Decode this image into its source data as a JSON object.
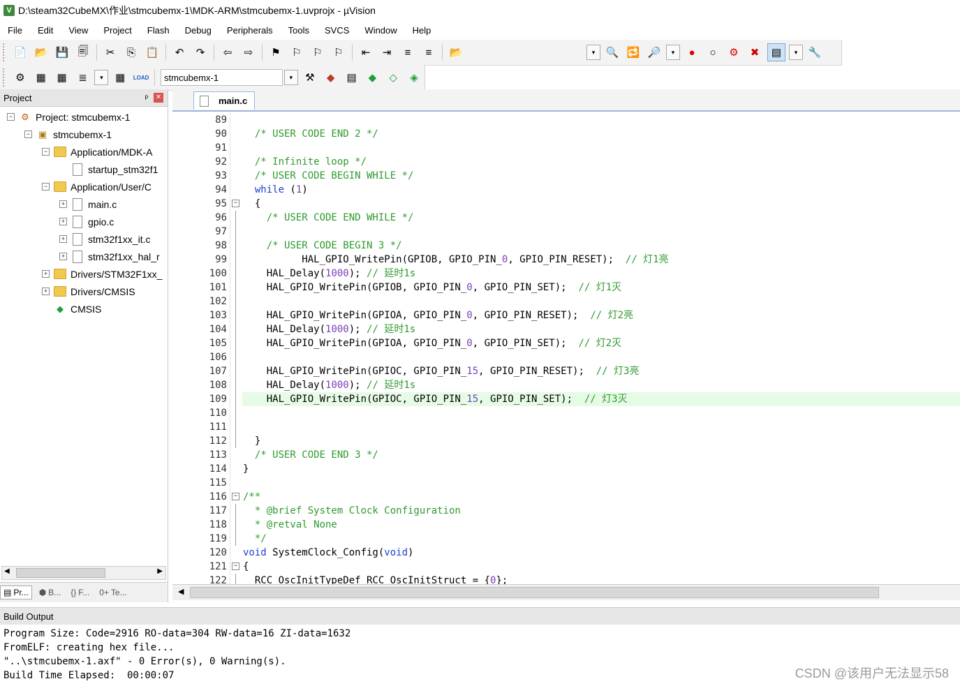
{
  "titlebar": {
    "icon": "V",
    "title": "D:\\steam32CubeMX\\作业\\stmcubemx-1\\MDK-ARM\\stmcubemx-1.uvprojx - µVision"
  },
  "menu": [
    "File",
    "Edit",
    "View",
    "Project",
    "Flash",
    "Debug",
    "Peripherals",
    "Tools",
    "SVCS",
    "Window",
    "Help"
  ],
  "toolbar": {
    "row1": [
      "📄",
      "📂",
      "💾",
      "🗐",
      "✂",
      "⎘",
      "📋",
      "↶",
      "↷",
      "⇦",
      "⇨",
      "⚑",
      "⚐",
      "⚐",
      "⚐",
      "⇤",
      "⇥",
      "≡",
      "≡",
      "📂"
    ],
    "row1_right": [
      "▾",
      "🔍",
      "🔁",
      "🔎",
      "▾",
      "●",
      "○",
      "⚙",
      "✖",
      "▤",
      "▾",
      "🔧"
    ],
    "row2": [
      "⚙",
      "▦",
      "▦",
      "≣",
      "▾",
      "▦",
      "LOAD"
    ],
    "target": "stmcubemx-1",
    "row2_right": [
      "⚒",
      "◆",
      "▤",
      "◆",
      "◇",
      "◈"
    ]
  },
  "project_panel": {
    "title": "Project",
    "pin": "ᵖ",
    "close": "✕",
    "tree": [
      {
        "level": 0,
        "exp": "−",
        "icon": "project",
        "label": "Project: stmcubemx-1"
      },
      {
        "level": 1,
        "exp": "−",
        "icon": "target",
        "label": "stmcubemx-1"
      },
      {
        "level": 2,
        "exp": "−",
        "icon": "folder",
        "label": "Application/MDK-A"
      },
      {
        "level": 3,
        "exp": "",
        "icon": "file",
        "label": "startup_stm32f1"
      },
      {
        "level": 2,
        "exp": "−",
        "icon": "folder",
        "label": "Application/User/C"
      },
      {
        "level": 3,
        "exp": "+",
        "icon": "file",
        "label": "main.c"
      },
      {
        "level": 3,
        "exp": "+",
        "icon": "file",
        "label": "gpio.c"
      },
      {
        "level": 3,
        "exp": "+",
        "icon": "file",
        "label": "stm32f1xx_it.c"
      },
      {
        "level": 3,
        "exp": "+",
        "icon": "file",
        "label": "stm32f1xx_hal_r"
      },
      {
        "level": 2,
        "exp": "+",
        "icon": "folder",
        "label": "Drivers/STM32F1xx_"
      },
      {
        "level": 2,
        "exp": "+",
        "icon": "folder",
        "label": "Drivers/CMSIS"
      },
      {
        "level": 2,
        "exp": "",
        "icon": "cmsis",
        "label": "CMSIS"
      }
    ],
    "tabs": [
      "Pr...",
      "B...",
      "F...",
      "Te..."
    ]
  },
  "editor": {
    "tab": "main.c",
    "lines": [
      {
        "n": "89",
        "fold": "",
        "code": ""
      },
      {
        "n": "90",
        "fold": "",
        "code": "  /* USER CODE END 2 */"
      },
      {
        "n": "91",
        "fold": "",
        "code": ""
      },
      {
        "n": "92",
        "fold": "",
        "code": "  /* Infinite loop */"
      },
      {
        "n": "93",
        "fold": "",
        "code": "  /* USER CODE BEGIN WHILE */"
      },
      {
        "n": "94",
        "fold": "",
        "code": "  while (1)"
      },
      {
        "n": "95",
        "fold": "−",
        "code": "  {"
      },
      {
        "n": "96",
        "fold": "|",
        "code": "    /* USER CODE END WHILE */"
      },
      {
        "n": "97",
        "fold": "|",
        "code": ""
      },
      {
        "n": "98",
        "fold": "|",
        "code": "    /* USER CODE BEGIN 3 */"
      },
      {
        "n": "99",
        "fold": "|",
        "code": "          HAL_GPIO_WritePin(GPIOB, GPIO_PIN_0, GPIO_PIN_RESET);  // 灯1亮"
      },
      {
        "n": "100",
        "fold": "|",
        "code": "    HAL_Delay(1000); // 延时1s"
      },
      {
        "n": "101",
        "fold": "|",
        "code": "    HAL_GPIO_WritePin(GPIOB, GPIO_PIN_0, GPIO_PIN_SET);  // 灯1灭"
      },
      {
        "n": "102",
        "fold": "|",
        "code": ""
      },
      {
        "n": "103",
        "fold": "|",
        "code": "    HAL_GPIO_WritePin(GPIOA, GPIO_PIN_0, GPIO_PIN_RESET);  // 灯2亮"
      },
      {
        "n": "104",
        "fold": "|",
        "code": "    HAL_Delay(1000); // 延时1s"
      },
      {
        "n": "105",
        "fold": "|",
        "code": "    HAL_GPIO_WritePin(GPIOA, GPIO_PIN_0, GPIO_PIN_SET);  // 灯2灭"
      },
      {
        "n": "106",
        "fold": "|",
        "code": ""
      },
      {
        "n": "107",
        "fold": "|",
        "code": "    HAL_GPIO_WritePin(GPIOC, GPIO_PIN_15, GPIO_PIN_RESET);  // 灯3亮"
      },
      {
        "n": "108",
        "fold": "|",
        "code": "    HAL_Delay(1000); // 延时1s"
      },
      {
        "n": "109",
        "fold": "|",
        "code": "    HAL_GPIO_WritePin(GPIOC, GPIO_PIN_15, GPIO_PIN_SET);  // 灯3灭"
      },
      {
        "n": "110",
        "fold": "|",
        "code": ""
      },
      {
        "n": "111",
        "fold": "|",
        "code": ""
      },
      {
        "n": "112",
        "fold": "|",
        "code": "  }"
      },
      {
        "n": "113",
        "fold": "",
        "code": "  /* USER CODE END 3 */"
      },
      {
        "n": "114",
        "fold": "",
        "code": "}"
      },
      {
        "n": "115",
        "fold": "",
        "code": ""
      },
      {
        "n": "116",
        "fold": "−",
        "code": "/**"
      },
      {
        "n": "117",
        "fold": "|",
        "code": "  * @brief System Clock Configuration"
      },
      {
        "n": "118",
        "fold": "|",
        "code": "  * @retval None"
      },
      {
        "n": "119",
        "fold": "|",
        "code": "  */"
      },
      {
        "n": "120",
        "fold": "",
        "code": "void SystemClock_Config(void)"
      },
      {
        "n": "121",
        "fold": "−",
        "code": "{"
      },
      {
        "n": "122",
        "fold": "|",
        "code": "  RCC_OscInitTypeDef RCC_OscInitStruct = {0};"
      }
    ],
    "highlight_line": "109"
  },
  "build_output": {
    "title": "Build Output",
    "lines": [
      "Program Size: Code=2916 RO-data=304 RW-data=16 ZI-data=1632",
      "FromELF: creating hex file...",
      "\"..\\stmcubemx-1.axf\" - 0 Error(s), 0 Warning(s).",
      "Build Time Elapsed:  00:00:07"
    ]
  },
  "watermark": "CSDN @该用户无法显示58",
  "colors": {
    "comment": "#2e9a2e",
    "keyword": "#1a3fd0",
    "number": "#7a3db8",
    "default": "#000000",
    "highlight": "#e6fbe6"
  }
}
